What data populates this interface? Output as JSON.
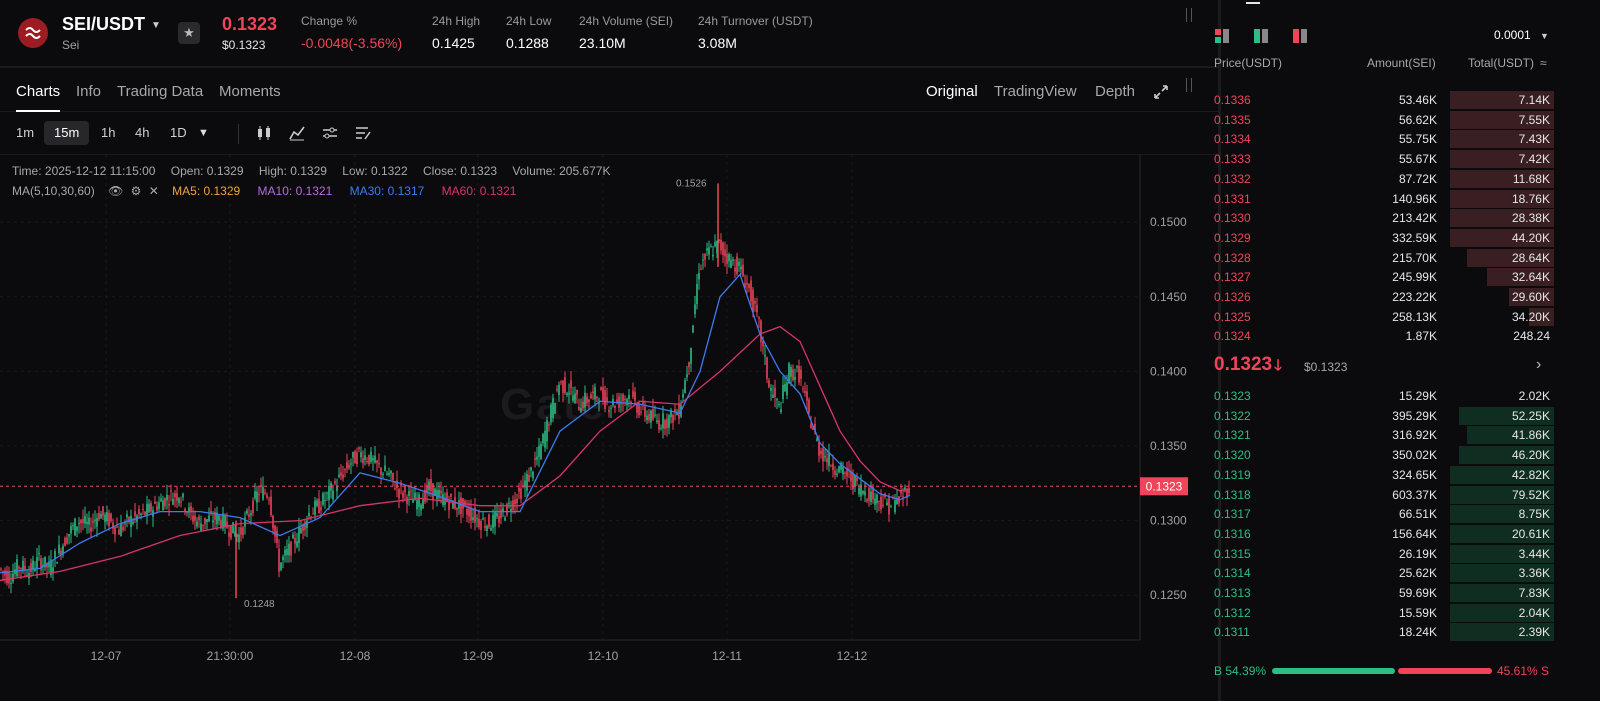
{
  "header": {
    "pair": "SEI/USDT",
    "pair_sub": "Sei",
    "price": "0.1323",
    "price_usd": "$0.1323",
    "stats": [
      {
        "label": "Change %",
        "value": "-0.0048(-3.56%)",
        "neg": true
      },
      {
        "label": "24h High",
        "value": "0.1425"
      },
      {
        "label": "24h Low",
        "value": "0.1288"
      },
      {
        "label": "24h Volume (SEI)",
        "value": "23.10M"
      },
      {
        "label": "24h Turnover (USDT)",
        "value": "3.08M"
      }
    ]
  },
  "tabs": {
    "left": [
      "Charts",
      "Info",
      "Trading Data",
      "Moments"
    ],
    "right": [
      "Original",
      "TradingView",
      "Depth"
    ]
  },
  "toolbar": {
    "timeframes": [
      "1m",
      "15m",
      "1h",
      "4h",
      "1D"
    ],
    "active": "15m"
  },
  "chart_info": {
    "time": "Time: 2025-12-12 11:15:00",
    "open": "Open: 0.1329",
    "high": "High: 0.1329",
    "low": "Low: 0.1322",
    "close": "Close: 0.1323",
    "volume": "Volume: 205.677K",
    "ma_label": "MA(5,10,30,60)",
    "ma5": "MA5: 0.1329",
    "ma10": "MA10: 0.1321",
    "ma30": "MA30: 0.1317",
    "ma60": "MA60: 0.1321"
  },
  "watermark": "Gate",
  "colors": {
    "up": "#2ebd85",
    "down": "#f0445a",
    "ma5": "#f0a53a",
    "ma10": "#b26bd9",
    "ma30": "#3d7bf0",
    "ma60": "#d9346a"
  },
  "chart_data": {
    "type": "line",
    "ylim": [
      0.122,
      0.1545
    ],
    "y_ticks": [
      "0.1500",
      "0.1450",
      "0.1400",
      "0.1350",
      "0.1300",
      "0.1250"
    ],
    "x_ticks": [
      "12-07",
      "21:30:00",
      "12-08",
      "12-09",
      "12-10",
      "12-11",
      "12-12"
    ],
    "current_price_label": "0.1323",
    "high_marker": "0.1526",
    "low_marker": "0.1248",
    "series": [
      {
        "key": "price",
        "x": [
          0,
          10,
          20,
          30,
          40,
          50,
          60,
          70,
          80,
          90,
          100,
          110,
          120,
          130,
          140,
          150,
          160,
          170,
          180,
          190,
          200,
          210,
          220,
          230,
          240,
          250,
          260,
          270,
          280,
          290,
          300,
          310,
          320,
          330,
          340,
          350,
          360,
          370,
          380,
          390,
          400,
          410,
          420,
          430,
          440,
          450,
          460,
          470,
          480,
          490,
          500,
          510,
          520,
          530,
          540,
          550,
          560,
          570,
          580,
          590,
          600,
          610,
          620,
          630,
          640,
          650,
          660,
          670,
          680,
          690,
          700,
          710,
          720,
          730,
          740,
          750,
          760,
          770,
          780,
          790,
          800,
          810,
          820,
          830,
          840,
          850,
          860,
          870,
          880,
          890,
          900,
          910
        ],
        "values": [
          0.1268,
          0.1262,
          0.127,
          0.1266,
          0.1274,
          0.1268,
          0.128,
          0.1292,
          0.13,
          0.1296,
          0.1305,
          0.13,
          0.1294,
          0.13,
          0.1303,
          0.1307,
          0.1312,
          0.1316,
          0.1318,
          0.1305,
          0.1298,
          0.1301,
          0.1302,
          0.1295,
          0.129,
          0.1305,
          0.132,
          0.1318,
          0.127,
          0.128,
          0.1292,
          0.1305,
          0.131,
          0.1318,
          0.1328,
          0.1338,
          0.1345,
          0.1342,
          0.1335,
          0.133,
          0.132,
          0.1316,
          0.1312,
          0.1322,
          0.1316,
          0.1313,
          0.131,
          0.1306,
          0.13,
          0.1298,
          0.1302,
          0.131,
          0.1318,
          0.133,
          0.1345,
          0.1368,
          0.1392,
          0.1388,
          0.1378,
          0.1382,
          0.1385,
          0.1378,
          0.138,
          0.1384,
          0.1375,
          0.137,
          0.1366,
          0.1368,
          0.1374,
          0.1408,
          0.147,
          0.148,
          0.1485,
          0.1475,
          0.147,
          0.1455,
          0.143,
          0.139,
          0.1375,
          0.14,
          0.1398,
          0.137,
          0.1348,
          0.134,
          0.1334,
          0.133,
          0.1322,
          0.1318,
          0.1314,
          0.131,
          0.1314,
          0.1323
        ]
      },
      {
        "key": "ma10",
        "x": [
          0,
          40,
          80,
          120,
          160,
          200,
          240,
          280,
          320,
          360,
          400,
          440,
          480,
          520,
          560,
          600,
          640,
          680,
          700,
          720,
          740,
          760,
          780,
          800,
          820,
          840,
          860,
          880,
          900,
          910
        ],
        "values": [
          0.1265,
          0.1268,
          0.1285,
          0.1298,
          0.1306,
          0.1306,
          0.1302,
          0.129,
          0.1302,
          0.1332,
          0.1325,
          0.1316,
          0.1306,
          0.1306,
          0.136,
          0.138,
          0.1378,
          0.1372,
          0.14,
          0.145,
          0.1465,
          0.1425,
          0.14,
          0.1385,
          0.1352,
          0.1338,
          0.1328,
          0.1318,
          0.1314,
          0.1317
        ]
      },
      {
        "key": "ma60",
        "x": [
          0,
          60,
          120,
          180,
          240,
          300,
          360,
          420,
          480,
          520,
          560,
          600,
          640,
          680,
          720,
          760,
          780,
          800,
          820,
          840,
          860,
          880,
          900,
          910
        ],
        "values": [
          0.126,
          0.1266,
          0.1276,
          0.129,
          0.1298,
          0.13,
          0.131,
          0.1315,
          0.131,
          0.131,
          0.133,
          0.136,
          0.138,
          0.1378,
          0.14,
          0.1425,
          0.143,
          0.142,
          0.139,
          0.136,
          0.134,
          0.1326,
          0.132,
          0.1321
        ]
      }
    ]
  },
  "orderbook": {
    "precision": "0.0001",
    "headers": {
      "price": "Price(USDT)",
      "amount": "Amount(SEI)",
      "total": "Total(USDT)"
    },
    "asks": [
      {
        "p": "0.1336",
        "a": "53.46K",
        "t": "7.14K",
        "d": 0.37
      },
      {
        "p": "0.1335",
        "a": "56.62K",
        "t": "7.55K",
        "d": 0.37
      },
      {
        "p": "0.1334",
        "a": "55.75K",
        "t": "7.43K",
        "d": 0.37
      },
      {
        "p": "0.1333",
        "a": "55.67K",
        "t": "7.42K",
        "d": 0.37
      },
      {
        "p": "0.1332",
        "a": "87.72K",
        "t": "11.68K",
        "d": 0.37
      },
      {
        "p": "0.1331",
        "a": "140.96K",
        "t": "18.76K",
        "d": 0.37
      },
      {
        "p": "0.1330",
        "a": "213.42K",
        "t": "28.38K",
        "d": 0.37
      },
      {
        "p": "0.1329",
        "a": "332.59K",
        "t": "44.20K",
        "d": 0.37
      },
      {
        "p": "0.1328",
        "a": "215.70K",
        "t": "28.64K",
        "d": 0.31
      },
      {
        "p": "0.1327",
        "a": "245.99K",
        "t": "32.64K",
        "d": 0.24
      },
      {
        "p": "0.1326",
        "a": "223.22K",
        "t": "29.60K",
        "d": 0.16
      },
      {
        "p": "0.1325",
        "a": "258.13K",
        "t": "34.20K",
        "d": 0.09
      },
      {
        "p": "0.1324",
        "a": "1.87K",
        "t": "248.24",
        "d": 0.0
      }
    ],
    "mid_price": "0.1323",
    "mid_usd": "$0.1323",
    "bids": [
      {
        "p": "0.1323",
        "a": "15.29K",
        "t": "2.02K",
        "d": 0.0
      },
      {
        "p": "0.1322",
        "a": "395.29K",
        "t": "52.25K",
        "d": 0.34
      },
      {
        "p": "0.1321",
        "a": "316.92K",
        "t": "41.86K",
        "d": 0.31
      },
      {
        "p": "0.1320",
        "a": "350.02K",
        "t": "46.20K",
        "d": 0.34
      },
      {
        "p": "0.1319",
        "a": "324.65K",
        "t": "42.82K",
        "d": 0.37
      },
      {
        "p": "0.1318",
        "a": "603.37K",
        "t": "79.52K",
        "d": 0.37
      },
      {
        "p": "0.1317",
        "a": "66.51K",
        "t": "8.75K",
        "d": 0.37
      },
      {
        "p": "0.1316",
        "a": "156.64K",
        "t": "20.61K",
        "d": 0.37
      },
      {
        "p": "0.1315",
        "a": "26.19K",
        "t": "3.44K",
        "d": 0.37
      },
      {
        "p": "0.1314",
        "a": "25.62K",
        "t": "3.36K",
        "d": 0.37
      },
      {
        "p": "0.1313",
        "a": "59.69K",
        "t": "7.83K",
        "d": 0.37
      },
      {
        "p": "0.1312",
        "a": "15.59K",
        "t": "2.04K",
        "d": 0.37
      },
      {
        "p": "0.1311",
        "a": "18.24K",
        "t": "2.39K",
        "d": 0.37
      }
    ],
    "buy_ratio": "B 54.39%",
    "sell_ratio": "45.61% S"
  }
}
